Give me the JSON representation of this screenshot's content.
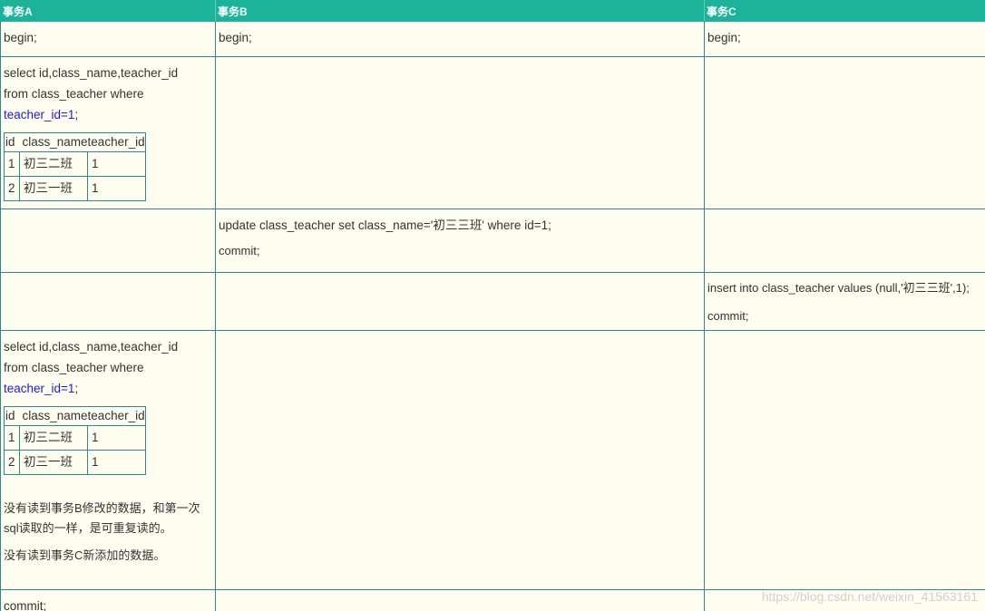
{
  "header": {
    "col_a": "事务A",
    "col_b": "事务B",
    "col_c": "事务C"
  },
  "rows": {
    "begin": {
      "a": "begin;",
      "b": "begin;",
      "c": "begin;"
    },
    "select1": {
      "stmt_line1": "select id,class_name,teacher_id",
      "stmt_line2": "from class_teacher where",
      "stmt_cond": "teacher_id=1",
      "stmt_end": ";",
      "result": {
        "headers": [
          "id",
          "class_name",
          "teacher_id"
        ],
        "rows": [
          [
            "1",
            "初三二班",
            "1"
          ],
          [
            "2",
            "初三一班",
            "1"
          ]
        ]
      }
    },
    "update": {
      "stmt": "update class_teacher set class_name='初三三班' where id=1;",
      "commit": "commit;"
    },
    "insert": {
      "stmt": "insert into class_teacher values (null,'初三三班',1);",
      "commit": "commit;"
    },
    "select2": {
      "stmt_line1": "select id,class_name,teacher_id",
      "stmt_line2": "from class_teacher where",
      "stmt_cond": "teacher_id=1",
      "stmt_end": ";",
      "result": {
        "headers": [
          "id",
          "class_name",
          "teacher_id"
        ],
        "rows": [
          [
            "1",
            "初三二班",
            "1"
          ],
          [
            "2",
            "初三一班",
            "1"
          ]
        ]
      },
      "note1": "没有读到事务B修改的数据，和第一次sql读取的一样，是可重复读的。",
      "note2": "没有读到事务C新添加的数据。"
    },
    "commit": {
      "a": "commit;"
    }
  },
  "watermark": "https://blog.csdn.net/weixin_41563161",
  "colors": {
    "header_bg": "#1bb39a",
    "border": "#2b8c8c",
    "page_bg": "#fffdf0",
    "condition_text": "#1a1aee"
  }
}
